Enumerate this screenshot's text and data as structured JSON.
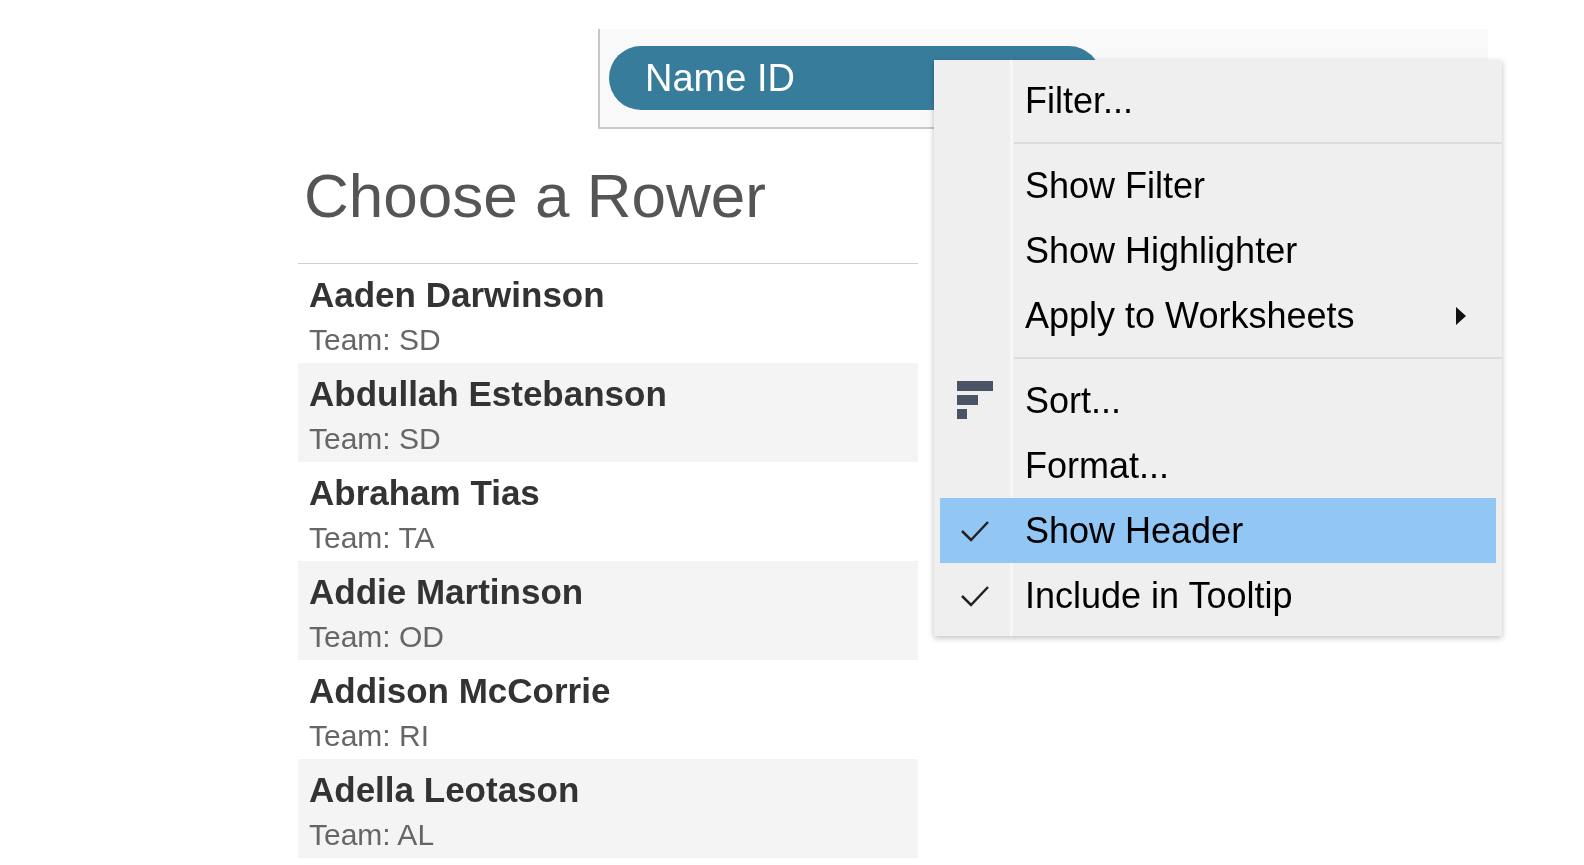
{
  "field_pill": {
    "label": "Name ID"
  },
  "title": "Choose a Rower",
  "rowers": [
    {
      "name": "Aaden Darwinson",
      "team": "Team: SD"
    },
    {
      "name": "Abdullah Estebanson",
      "team": "Team: SD"
    },
    {
      "name": "Abraham Tias",
      "team": "Team: TA"
    },
    {
      "name": "Addie Martinson",
      "team": "Team: OD"
    },
    {
      "name": "Addison McCorrie",
      "team": "Team: RI"
    },
    {
      "name": "Adella Leotason",
      "team": "Team: AL"
    }
  ],
  "context_menu": {
    "groups": [
      [
        {
          "label": "Filter...",
          "checked": false,
          "selected": false,
          "submenu": false
        }
      ],
      [
        {
          "label": "Show Filter",
          "checked": false,
          "selected": false,
          "submenu": false
        },
        {
          "label": "Show Highlighter",
          "checked": false,
          "selected": false,
          "submenu": false
        },
        {
          "label": "Apply to Worksheets",
          "checked": false,
          "selected": false,
          "submenu": true
        }
      ],
      [
        {
          "label": "Sort...",
          "checked": false,
          "selected": false,
          "submenu": false,
          "kind": "sort"
        },
        {
          "label": "Format...",
          "checked": false,
          "selected": false,
          "submenu": false
        },
        {
          "label": "Show Header",
          "checked": true,
          "selected": true,
          "submenu": false
        },
        {
          "label": "Include in Tooltip",
          "checked": true,
          "selected": false,
          "submenu": false
        }
      ]
    ]
  }
}
